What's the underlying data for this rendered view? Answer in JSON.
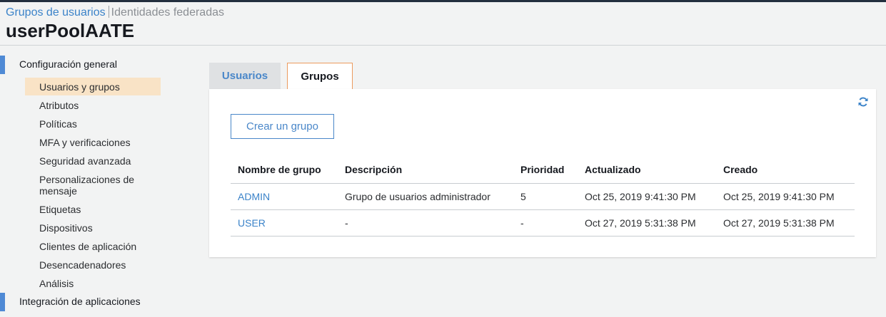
{
  "breadcrumb": {
    "groups": "Grupos de usuarios",
    "federated": "Identidades federadas"
  },
  "page_title": "userPoolAATE",
  "sidebar": {
    "general_section": "Configuración general",
    "items": [
      {
        "label": "Usuarios y grupos",
        "active": true
      },
      {
        "label": "Atributos"
      },
      {
        "label": "Políticas"
      },
      {
        "label": "MFA y verificaciones"
      },
      {
        "label": "Seguridad avanzada"
      },
      {
        "label": "Personalizaciones de mensaje"
      },
      {
        "label": "Etiquetas"
      },
      {
        "label": "Dispositivos"
      },
      {
        "label": "Clientes de aplicación"
      },
      {
        "label": "Desencadenadores"
      },
      {
        "label": "Análisis"
      }
    ],
    "integration_section": "Integración de aplicaciones"
  },
  "tabs": {
    "users": "Usuarios",
    "groups": "Grupos"
  },
  "panel": {
    "refresh_icon": "refresh-icon",
    "create_button": "Crear un grupo",
    "table": {
      "headers": [
        "Nombre de grupo",
        "Descripción",
        "Prioridad",
        "Actualizado",
        "Creado"
      ],
      "rows": [
        [
          "ADMIN",
          "Grupo de usuarios administrador",
          "5",
          "Oct 25, 2019 9:41:30 PM",
          "Oct 25, 2019 9:41:30 PM"
        ],
        [
          "USER",
          "-",
          "-",
          "Oct 27, 2019 5:31:38 PM",
          "Oct 27, 2019 5:31:38 PM"
        ]
      ]
    }
  },
  "colors": {
    "link": "#3b83c9",
    "active_item_bg": "#f9e3c6",
    "section_bar": "#4f8ad5",
    "active_tab_border": "#ec9a5e"
  }
}
